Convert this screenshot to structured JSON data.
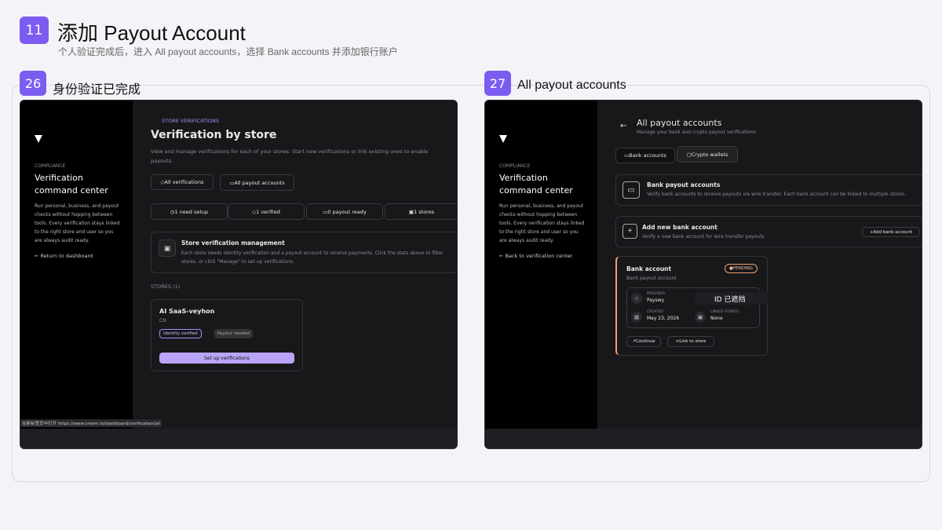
{
  "header": {
    "step": "11",
    "title": "添加 Payout Account",
    "subtitle": "个人验证完成后，进入 All payout accounts，选择 Bank accounts 并添加银行账户"
  },
  "left": {
    "step": "26",
    "caption": "身份验证已完成",
    "sidebar": {
      "compliance": "COMPLIANCE",
      "title1": "Verification",
      "title2": "command center",
      "desc": [
        "Run personal, business, and payout",
        "checks without hopping between",
        "tools. Every verification stays linked",
        "to the right store and user so you",
        "are always audit ready."
      ],
      "back": "Return to dashboard"
    },
    "main": {
      "eyebrow": "STORE VERIFICATIONS",
      "title": "Verification by store",
      "desc1": "View and manage verifications for each of your stores. Start new verifications or link existing ones to enable",
      "desc2": "payouts.",
      "btn_all": "All verifications",
      "btn_payout": "All payout accounts",
      "stats": [
        "1 need setup",
        "1 verified",
        "0 payout ready",
        "1 stores"
      ],
      "mgmt_title": "Store verification management",
      "mgmt_desc1": "Each store needs identity verification and a payout account to receive payments. Click the stats above to filter",
      "mgmt_desc2": "stores, or click \"Manage\" to set up verifications.",
      "stores_label": "STORES (1)",
      "store_name": "AI SaaS-veyhon",
      "store_country": "CN",
      "badge_identity": "Identity verified",
      "badge_payout": "Payout needed",
      "setup_btn": "Set up verifications"
    },
    "status_url": "在新标签页中打开 https://www.creem.io/dashboard/verification/all"
  },
  "right": {
    "step": "27",
    "caption": "All payout accounts",
    "sidebar": {
      "back": "Back to verification center"
    },
    "main": {
      "title": "All payout accounts",
      "subtitle": "Manage your bank and crypto payout verifications",
      "tab_bank": "Bank accounts",
      "tab_crypto": "Crypto wallets",
      "bp_title": "Bank payout accounts",
      "bp_desc": "Verify bank accounts to receive payouts via wire transfer. Each bank account can be linked to multiple stores.",
      "add_title": "Add new bank account",
      "add_desc": "Verify a new bank account for wire transfer payouts",
      "add_btn": "Add bank account",
      "acct_title": "Bank account",
      "acct_sub": "Bank payout account",
      "pending": "PENDING",
      "provider_l": "PROVIDER",
      "provider_v": "Payswy",
      "created_l": "CREATED",
      "created_v": "May 23, 2026",
      "linked_l": "LINKED STORES",
      "linked_v": "None",
      "masked": "ID 已遮挡",
      "continue": "Continue",
      "link": "Link to store"
    }
  },
  "colors": {
    "accent": "#7c5cf0",
    "pending": "#f0a070"
  }
}
